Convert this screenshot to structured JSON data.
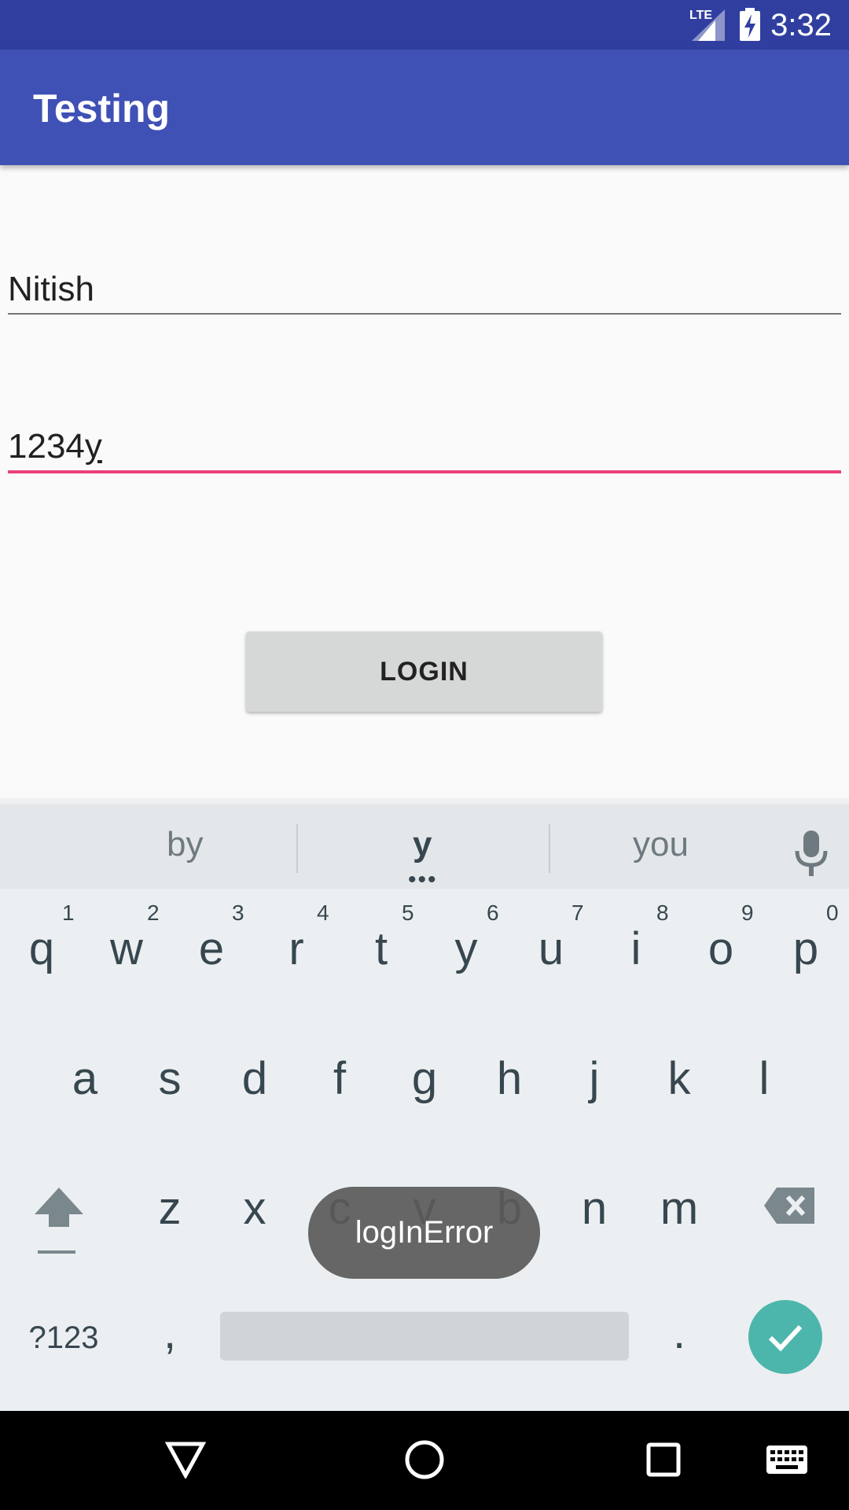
{
  "status_bar": {
    "time": "3:32",
    "network": "LTE"
  },
  "app_bar": {
    "title": "Testing"
  },
  "form": {
    "username_value": "Nitish",
    "password_value_prefix": "1234",
    "password_value_cursor": "y",
    "login_label": "LOGIN"
  },
  "keyboard": {
    "suggestions": [
      "by",
      "y",
      "you"
    ],
    "row1": [
      "q",
      "w",
      "e",
      "r",
      "t",
      "y",
      "u",
      "i",
      "o",
      "p"
    ],
    "row1_numbers": [
      "1",
      "2",
      "3",
      "4",
      "5",
      "6",
      "7",
      "8",
      "9",
      "0"
    ],
    "row2": [
      "a",
      "s",
      "d",
      "f",
      "g",
      "h",
      "j",
      "k",
      "l"
    ],
    "row3": [
      "z",
      "x",
      "c",
      "v",
      "b",
      "n",
      "m"
    ],
    "symbols_label": "?123",
    "comma": ",",
    "period": "."
  },
  "toast": {
    "message": "logInError"
  },
  "icons": {
    "signal": "signal-icon",
    "battery": "battery-charging-icon",
    "mic": "mic-icon",
    "shift": "shift-icon",
    "backspace": "backspace-icon",
    "enter": "checkmark-icon",
    "back": "back-icon",
    "home": "home-icon",
    "recents": "recents-icon",
    "keyboard": "keyboard-icon"
  },
  "colors": {
    "status_bar": "#303f9f",
    "app_bar": "#3f51b5",
    "accent": "#ec407a",
    "enter_key": "#4db6ac"
  }
}
